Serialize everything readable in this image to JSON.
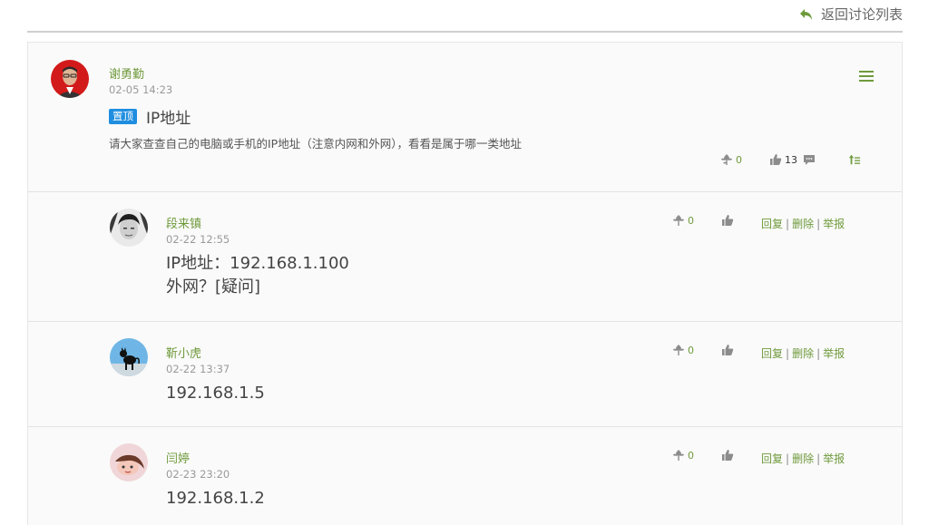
{
  "header": {
    "back_label": "返回讨论列表"
  },
  "post": {
    "author": "谢勇勤",
    "time": "02-05 14:23",
    "badge": "置顶",
    "title": "IP地址",
    "body": "请大家查查自己的电脑或手机的IP地址（注意内网和外网），看看是属于哪一类地址",
    "flower_count": "0",
    "like_count": "13"
  },
  "replies": [
    {
      "author": "段来镇",
      "time": "02-22 12:55",
      "content_line1": "IP地址：192.168.1.100",
      "content_line2": "外网？[疑问]",
      "flower_count": "0"
    },
    {
      "author": "靳小虎",
      "time": "02-22 13:37",
      "content_line1": "192.168.1.5",
      "content_line2": "",
      "flower_count": "0"
    },
    {
      "author": "闫婷",
      "time": "02-23 23:20",
      "content_line1": "192.168.1.2",
      "content_line2": "",
      "flower_count": "0"
    }
  ],
  "reply_actions": {
    "reply": "回复",
    "delete": "删除",
    "report": "举报",
    "separator": "|"
  },
  "colors": {
    "accent": "#6f9a3c",
    "badge": "#1f8ee0",
    "icon_gray": "#8c8c8c"
  }
}
